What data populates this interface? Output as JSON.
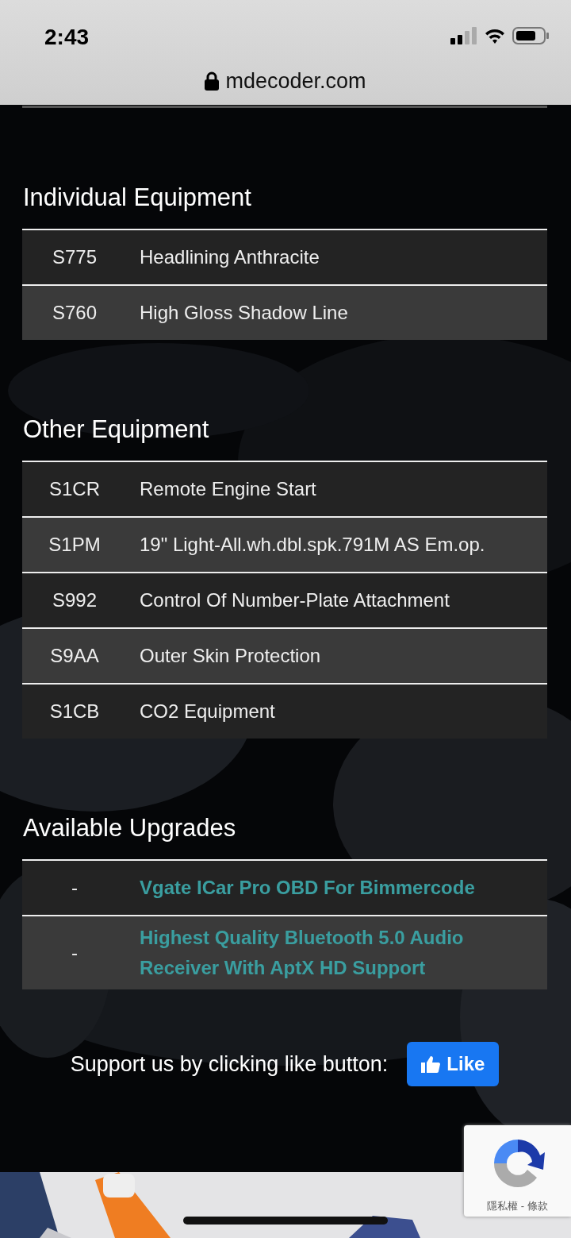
{
  "status_bar": {
    "time": "2:43"
  },
  "address_bar": {
    "url": "mdecoder.com"
  },
  "sections": [
    {
      "title": "Individual Equipment",
      "rows": [
        {
          "kind": "equipment",
          "code": "S775",
          "name": "Headlining Anthracite"
        },
        {
          "kind": "equipment",
          "code": "S760",
          "name": "High Gloss Shadow Line"
        }
      ]
    },
    {
      "title": "Other Equipment",
      "rows": [
        {
          "kind": "equipment",
          "code": "S1CR",
          "name": "Remote Engine Start"
        },
        {
          "kind": "equipment",
          "code": "S1PM",
          "name": "19\" Light-All.wh.dbl.spk.791M AS Em.op."
        },
        {
          "kind": "equipment",
          "code": "S992",
          "name": "Control Of Number-Plate Attachment"
        },
        {
          "kind": "equipment",
          "code": "S9AA",
          "name": "Outer Skin Protection"
        },
        {
          "kind": "equipment",
          "code": "S1CB",
          "name": "CO2 Equipment"
        }
      ]
    },
    {
      "title": "Available Upgrades",
      "rows": [
        {
          "kind": "link",
          "code": "-",
          "name": "Vgate ICar Pro OBD For Bimmercode"
        },
        {
          "kind": "link",
          "code": "-",
          "name": "Highest Quality Bluetooth 5.0 Audio Receiver With AptX HD Support"
        }
      ]
    }
  ],
  "support": {
    "text": "Support us by clicking like button:",
    "button": "Like"
  },
  "recaptcha": {
    "links": "隱私權 - 條款"
  }
}
